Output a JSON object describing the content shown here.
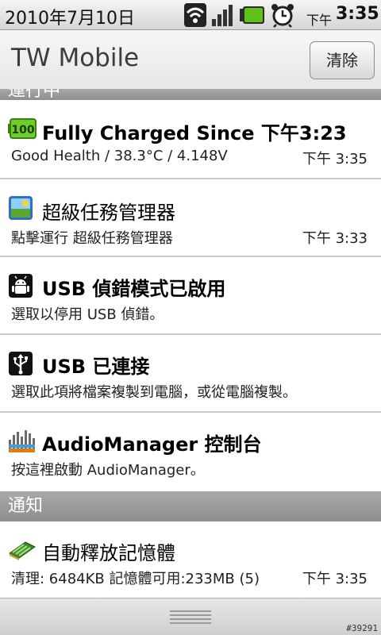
{
  "status_bar": {
    "date": "2010年7月10日",
    "ampm": "下午",
    "time": "3:35",
    "icons": [
      "wifi-icon",
      "signal-icon",
      "battery-icon",
      "alarm-icon"
    ]
  },
  "header": {
    "title": "TW Mobile",
    "clear_label": "清除"
  },
  "sections": {
    "ongoing_label": "運行中",
    "notifications_label": "通知"
  },
  "ongoing": [
    {
      "icon": "battery-100-icon",
      "title": "Fully Charged Since",
      "title_suffix": "下午3:23",
      "text": "Good Health / 38.3°C / 4.148V",
      "time": "下午 3:35"
    },
    {
      "icon": "task-manager-icon",
      "title": "超級任務管理器",
      "text": "點擊運行 超級任務管理器",
      "time": "下午 3:33"
    },
    {
      "icon": "android-debug-icon",
      "title": "USB 偵錯模式已啟用",
      "text": "選取以停用 USB 偵錯。"
    },
    {
      "icon": "usb-icon",
      "title": "USB 已連接",
      "text": "選取此項將檔案複製到電腦，或從電腦複製。"
    },
    {
      "icon": "equalizer-icon",
      "title": "AudioManager 控制台",
      "text": "按這裡啟動 AudioManager。"
    }
  ],
  "notifications": [
    {
      "icon": "memory-chip-icon",
      "title": "自動釋放記憶體",
      "text": "清理: 6484KB 記憶體可用:233MB (5)",
      "time": "下午 3:35"
    }
  ],
  "watermark": "#39291",
  "colors": {
    "battery_green": "#4caf1a",
    "section_gray": "#9b9b9b"
  }
}
